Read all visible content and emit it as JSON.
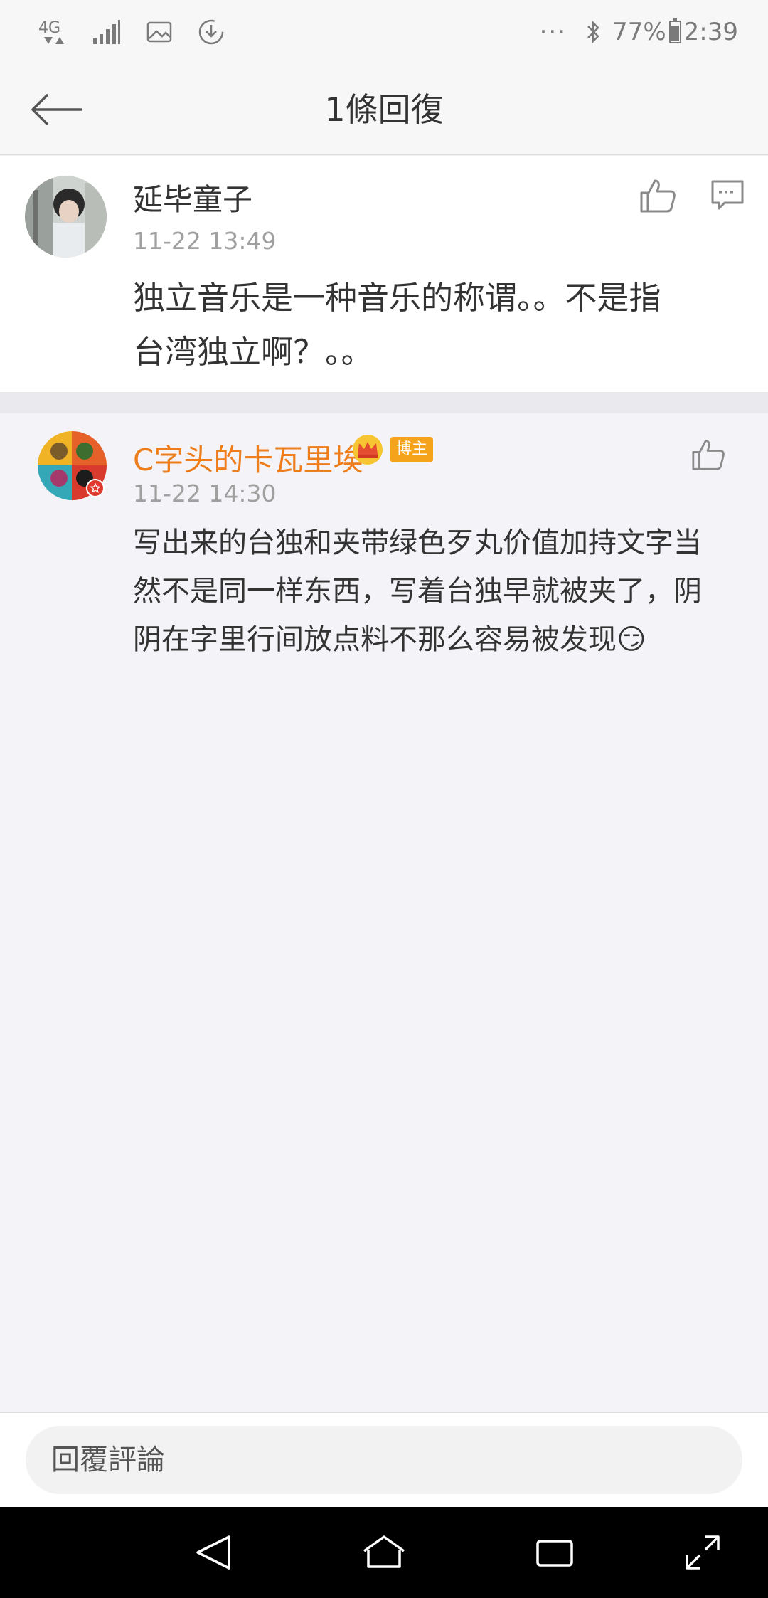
{
  "status_bar": {
    "network": "4G",
    "battery_pct": "77%",
    "time": "2:39",
    "battery_level": 0.77,
    "overflow": "···"
  },
  "nav": {
    "title": "1條回復",
    "back_icon": "arrow-left-icon"
  },
  "comment": {
    "author": "延毕童子",
    "time": "11-22 13:49",
    "text_line1": "独立音乐是一种音乐的称谓。。不是指",
    "text_line2": "台湾独立啊？。。",
    "like_icon": "thumbs-up-icon",
    "reply_icon": "comment-icon"
  },
  "reply": {
    "author": "C字头的卡瓦里埃",
    "author_color": "#ee7e1c",
    "badge": "博主",
    "time": "11-22 14:30",
    "text_line1": "写出来的台独和夹带绿色歹丸价值加持文字当",
    "text_line2": "然不是同一样东西，写着台独早就被夹了，阴",
    "text_line3": "阴在字里行间放点料不那么容易被发现😏",
    "like_icon": "thumbs-up-icon"
  },
  "reply_bar": {
    "placeholder": "回覆評論"
  },
  "system_nav": {
    "back": "triangle-back-icon",
    "home": "home-icon",
    "recents": "recents-icon",
    "expand": "expand-icon"
  }
}
